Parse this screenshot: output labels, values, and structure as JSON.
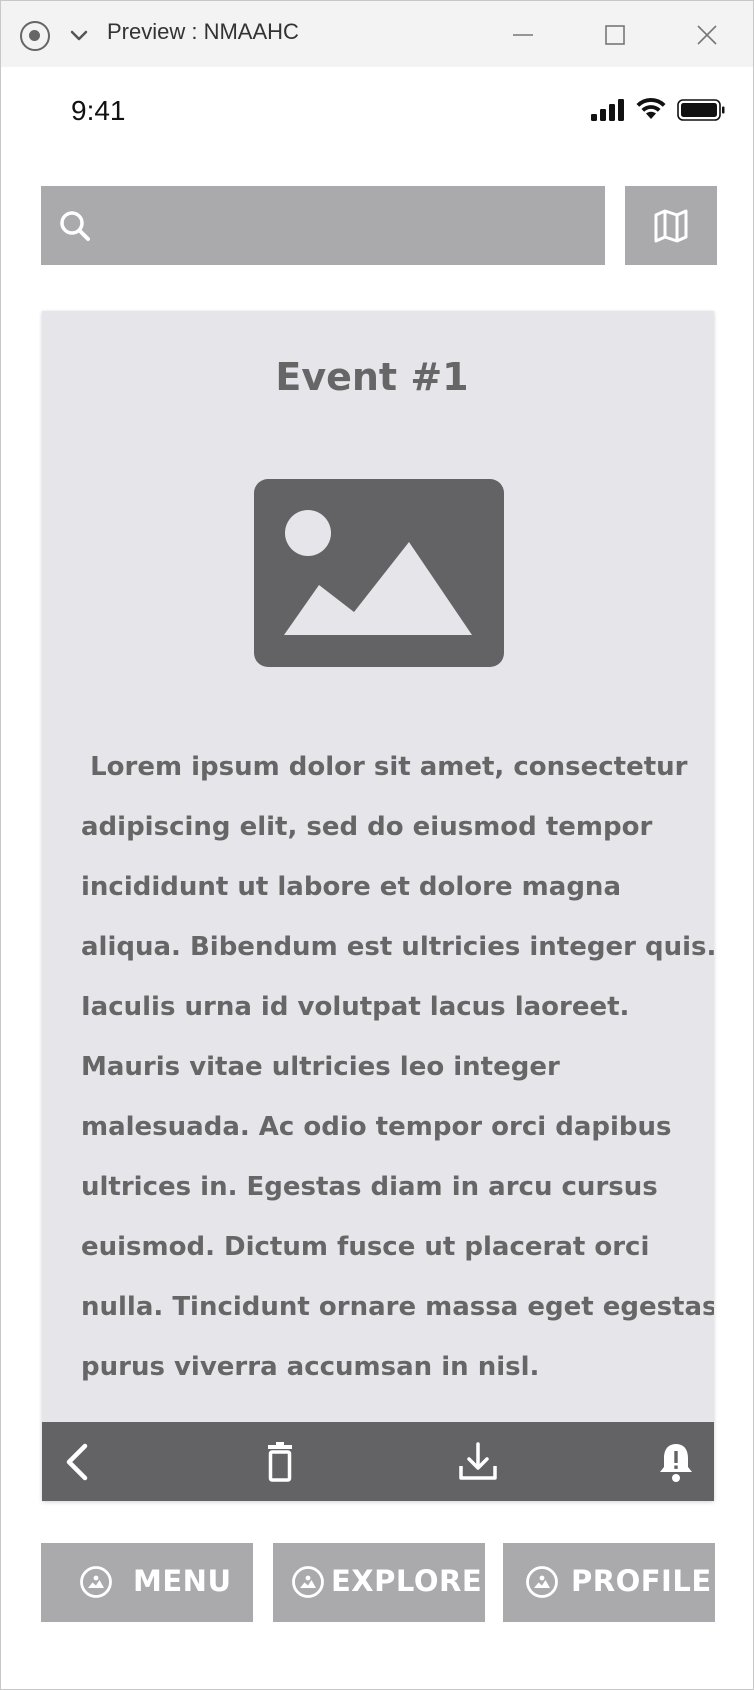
{
  "window": {
    "title": "Preview : NMAAHC"
  },
  "status_bar": {
    "time": "9:41"
  },
  "search": {
    "value": ""
  },
  "card": {
    "title": "Event #1",
    "body": " Lorem ipsum dolor sit amet, consectetur adipiscing elit, sed do eiusmod tempor incididunt ut labore et dolore magna aliqua. Bibendum est ultricies integer quis. Iaculis urna id volutpat lacus laoreet. Mauris vitae ultricies leo integer malesuada. Ac odio tempor orci dapibus ultrices in. Egestas diam in arcu cursus euismod. Dictum fusce ut placerat orci nulla. Tincidunt ornare massa eget egestas purus viverra accumsan in nisl."
  },
  "toolbar": {
    "icons": [
      "back-icon",
      "delete-icon",
      "download-icon",
      "bell-icon"
    ]
  },
  "bottom_nav": {
    "menu_label": "MENU",
    "explore_label": "EXPLORE",
    "profile_label": "PROFILE"
  },
  "colors": {
    "button_gray": "#aaaaad",
    "card_bg": "#e5e5ea",
    "dark_gray": "#636365",
    "text_gray": "#666667"
  }
}
